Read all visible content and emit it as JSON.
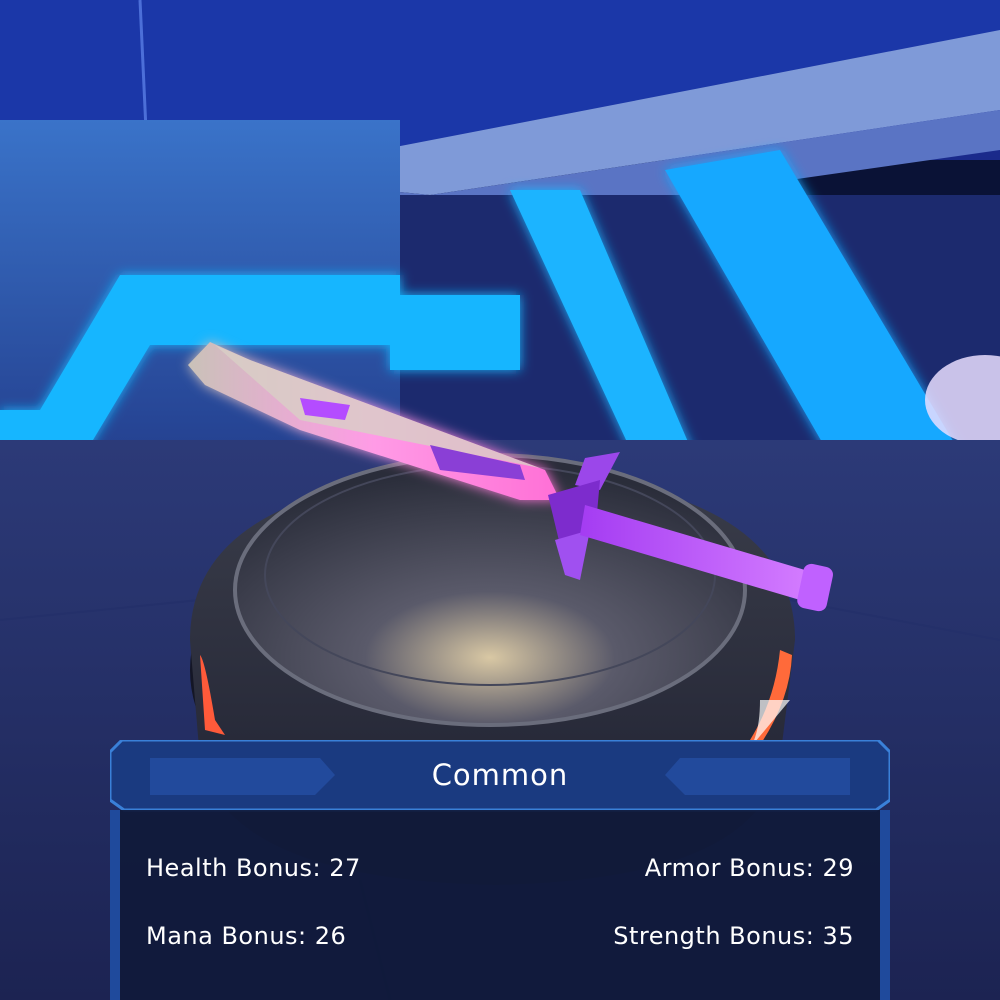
{
  "item": {
    "rarity": "Common",
    "stats": {
      "health": "Health Bonus: 27",
      "armor": "Armor Bonus: 29",
      "mana": "Mana Bonus: 26",
      "strength": "Strength Bonus: 35"
    }
  },
  "colors": {
    "neon_blue": "#19b6ff",
    "blade_pink": "#ff7ad9",
    "hilt_purple": "#b04cff",
    "panel_bg": "#0f1b3d",
    "panel_border": "#2f74c8"
  },
  "icons": {
    "weapon": "sword-icon"
  }
}
